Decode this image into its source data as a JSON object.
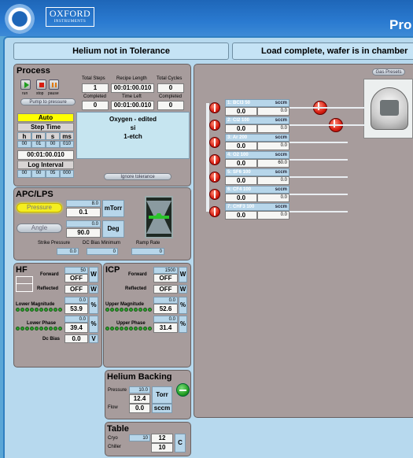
{
  "header": {
    "logo_brand": "OXFORD",
    "logo_sub": "INSTRUMENTS",
    "title_partial": "Pro"
  },
  "banners": {
    "helium": "Helium  not in Tolerance",
    "load": "Load complete, wafer is in chamber"
  },
  "process": {
    "title": "Process",
    "buttons": {
      "run": "run",
      "stop": "stop",
      "pause": "pause",
      "pump": "Pump to pressure"
    },
    "total_steps_label": "Total Steps",
    "total_steps": "1",
    "recipe_length_label": "Recipe Length",
    "recipe_length": "00:01:00.010",
    "total_cycles_label": "Total Cycles",
    "total_cycles": "0",
    "completed_label": "Completed",
    "completed_steps": "0",
    "time_left_label": "Time Left",
    "time_left": "00:01:00.010",
    "completed_cycles_label": "Completed",
    "completed_cycles": "0",
    "mode": "Auto",
    "step_time_label": "Step Time",
    "step_time_units": [
      "h",
      "m",
      "s",
      "ms"
    ],
    "step_time_parts": [
      "00",
      "01",
      "00",
      "010"
    ],
    "step_time": "00:01:00.010",
    "log_interval_label": "Log Interval",
    "log_interval_parts": [
      "00",
      "00",
      "05",
      "000"
    ],
    "recipe_lines": [
      "Oxygen - edited",
      "si",
      "1-etch"
    ],
    "ignore_tolerance": "Ignore tolerance"
  },
  "apc": {
    "title": "APC/LPS",
    "pressure_btn": "Pressure",
    "pressure_sp": "8.0",
    "pressure": "0.1",
    "pressure_unit": "mTorr",
    "angle_btn": "Angle",
    "angle_sp": "0.0",
    "angle": "90.0",
    "angle_unit": "Deg",
    "strike_label": "Strike Pressure",
    "strike": "0.0",
    "dcbias_min_label": "DC Bias Minimum",
    "dcbias_min": "0",
    "ramp_label": "Ramp Rate",
    "ramp": "0"
  },
  "hf": {
    "title": "HF",
    "forward_label": "Forward",
    "forward_sp": "50",
    "forward": "OFF",
    "reflected_label": "Reflected",
    "reflected": "OFF",
    "w": "W",
    "lower_mag_label": "Lower Magnitude",
    "lower_mag_sp": "0.0",
    "lower_mag": "53.9",
    "lower_phase_label": "Lower Phase",
    "lower_phase_sp": "0.0",
    "lower_phase": "39.4",
    "pct": "%",
    "dc_bias_label": "Dc Bias",
    "dc_bias": "0.0",
    "v": "V"
  },
  "icp": {
    "title": "ICP",
    "forward_label": "Forward",
    "forward_sp": "1500",
    "forward": "OFF",
    "reflected_label": "Reflected",
    "reflected": "OFF",
    "w": "W",
    "upper_mag_label": "Upper Magnitude",
    "upper_mag_sp": "0.0",
    "upper_mag": "52.6",
    "upper_phase_label": "Upper Phase",
    "upper_phase_sp": "0.0",
    "upper_phase": "31.4",
    "pct": "%"
  },
  "helium_backing": {
    "title": "Helium Backing",
    "pressure_label": "Pressure",
    "pressure_sp": "10.0",
    "pressure": "12.4",
    "torr": "Torr",
    "flow_label": "Flow",
    "flow": "0.0",
    "sccm": "sccm"
  },
  "table": {
    "title": "Table",
    "cryo_label": "Cryo",
    "cryo_sp": "10",
    "cryo": "12",
    "chiller_label": "Chiller",
    "chiller": "10",
    "unit": "C"
  },
  "gas": {
    "presets_btn": "Gas Presets",
    "lines": [
      {
        "name": "1:  BCl3 50",
        "unit": "sccm",
        "value": "0.0",
        "setpoint": "0.0"
      },
      {
        "name": "2:  Cl2 100",
        "unit": "sccm",
        "value": "0.0",
        "setpoint": "0.0"
      },
      {
        "name": "3:  Ar 200",
        "unit": "sccm",
        "value": "0.0",
        "setpoint": "0.0"
      },
      {
        "name": "4:  O2 100",
        "unit": "sccm",
        "value": "0.0",
        "setpoint": "60.0"
      },
      {
        "name": "5:  SF6 100",
        "unit": "sccm",
        "value": "0.0",
        "setpoint": "0.0"
      },
      {
        "name": "6:  CF4 100",
        "unit": "sccm",
        "value": "0.0",
        "setpoint": "0.0"
      },
      {
        "name": "7:  CHF3 100",
        "unit": "sccm",
        "value": "0.0",
        "setpoint": "0.0"
      }
    ]
  },
  "colors": {
    "panel": "#a79c9c",
    "background": "#b7d9ee",
    "header": "#1e66b8",
    "auto": "#ffff00",
    "valve": "#d81d10",
    "status_ok": "#2fa02f"
  }
}
